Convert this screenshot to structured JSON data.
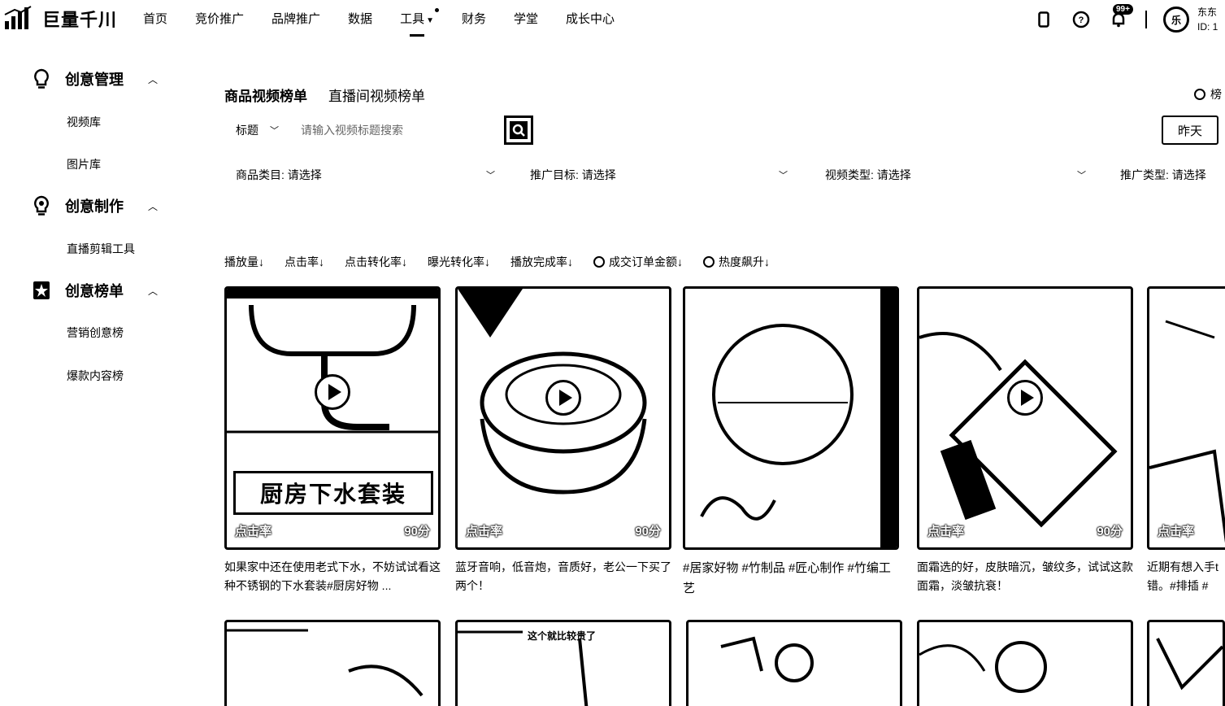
{
  "app": {
    "brand": "巨量千川"
  },
  "nav": {
    "items": [
      {
        "label": "首页"
      },
      {
        "label": "竞价推广"
      },
      {
        "label": "品牌推广"
      },
      {
        "label": "数据"
      },
      {
        "label": "工具"
      },
      {
        "label": "财务"
      },
      {
        "label": "学堂"
      },
      {
        "label": "成长中心"
      }
    ],
    "active": "工具"
  },
  "header_right": {
    "notification_badge": "99+",
    "avatar_text": "乐",
    "user_name": "东东",
    "user_id": "ID: 1"
  },
  "sidebar": {
    "groups": [
      {
        "label": "创意管理",
        "icon": "lightbulb-icon",
        "items": [
          "视频库",
          "图片库"
        ]
      },
      {
        "label": "创意制作",
        "icon": "bulb-gear-icon",
        "items": [
          "直播剪辑工具"
        ]
      },
      {
        "label": "创意榜单",
        "icon": "star-badge-icon",
        "items": [
          "营销创意榜",
          "爆款内容榜"
        ]
      }
    ]
  },
  "main": {
    "tabs": [
      "商品视频榜单",
      "直播间视频榜单"
    ],
    "active_tab": "商品视频榜单",
    "rank_radio_label": "榜",
    "search": {
      "type_label": "标题",
      "placeholder": "请输入视频标题搜索",
      "value": ""
    },
    "date_button": "昨天",
    "filters": [
      {
        "label": "商品类目:",
        "value": "请选择"
      },
      {
        "label": "推广目标:",
        "value": "请选择"
      },
      {
        "label": "视频类型:",
        "value": "请选择"
      },
      {
        "label": "推广类型:",
        "value": "请选择"
      }
    ],
    "sorts": [
      {
        "label": "播放量↓",
        "radio": false
      },
      {
        "label": "点击率↓",
        "radio": false
      },
      {
        "label": "点击转化率↓",
        "radio": false
      },
      {
        "label": "曝光转化率↓",
        "radio": false
      },
      {
        "label": "播放完成率↓",
        "radio": false
      },
      {
        "label": "成交订单金额↓",
        "radio": true
      },
      {
        "label": "热度飙升↓",
        "radio": true
      }
    ],
    "cards": [
      {
        "metric": "点击率",
        "score": "90分",
        "banner": "厨房下水套装",
        "desc": "如果家中还在使用老式下水，不妨试试看这种不锈钢的下水套装#厨房好物 ..."
      },
      {
        "metric": "点击率",
        "score": "90分",
        "desc": "蓝牙音响，低音炮，音质好，老公一下买了两个！"
      },
      {
        "metric": "",
        "score": "",
        "desc": "#居家好物 #竹制品 #匠心制作 #竹编工艺"
      },
      {
        "metric": "点击率",
        "score": "90分",
        "desc": "面霜选的好，皮肤暗沉，皱纹多，试试这款面霜，淡皱抗衰！"
      },
      {
        "metric": "点击率",
        "score": "",
        "desc": "近期有想入手t错。#排插 #"
      }
    ],
    "second_row_caption": "这个就比较贵了"
  }
}
